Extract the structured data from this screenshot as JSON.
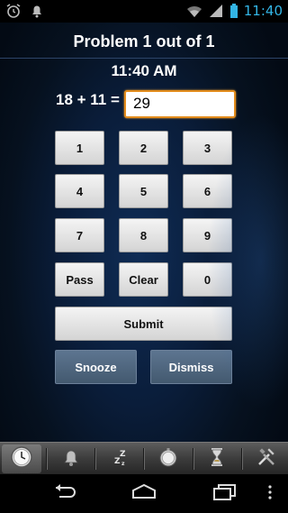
{
  "status_bar": {
    "time": "11:40",
    "icons": [
      "alarm-clock-icon",
      "notification-bell-icon",
      "wifi-icon",
      "signal-icon",
      "battery-icon"
    ]
  },
  "screen": {
    "title": "Problem 1 out of 1",
    "time": "11:40 AM",
    "equation": "18 + 11  =",
    "answer_value": "29"
  },
  "keypad": {
    "keys": [
      "1",
      "2",
      "3",
      "4",
      "5",
      "6",
      "7",
      "8",
      "9",
      "Pass",
      "Clear",
      "0"
    ]
  },
  "actions": {
    "submit": "Submit",
    "snooze": "Snooze",
    "dismiss": "Dismiss"
  },
  "toolbar": {
    "items": [
      "clock-icon",
      "bell-icon",
      "sleep-icon",
      "stopwatch-icon",
      "timer-icon",
      "tools-icon"
    ],
    "active": "clock-icon"
  },
  "nav": {
    "items": [
      "back-icon",
      "home-icon",
      "recent-apps-icon",
      "menu-icon"
    ]
  },
  "colors": {
    "accent_orange": "#e38c1c",
    "status_blue": "#33b5e5",
    "dark_button": "#4e6680"
  }
}
